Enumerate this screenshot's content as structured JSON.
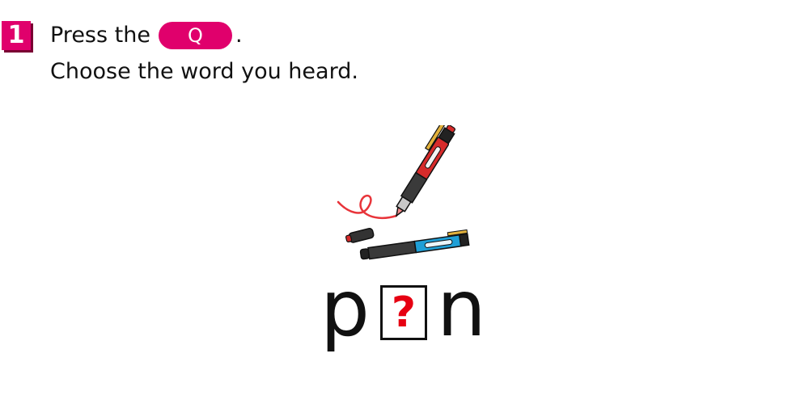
{
  "step": {
    "number": "1"
  },
  "instruction": {
    "press_prefix": "Press the",
    "button_label": "Q",
    "press_suffix": ".",
    "line2": "Choose the word you heard."
  },
  "illustration": {
    "icon": "pen-and-marker-icon"
  },
  "puzzle": {
    "letter_before": "p",
    "missing_marker": "?",
    "letter_after": "n"
  },
  "colors": {
    "accent": "#e0006c",
    "question_mark": "#e60012"
  }
}
